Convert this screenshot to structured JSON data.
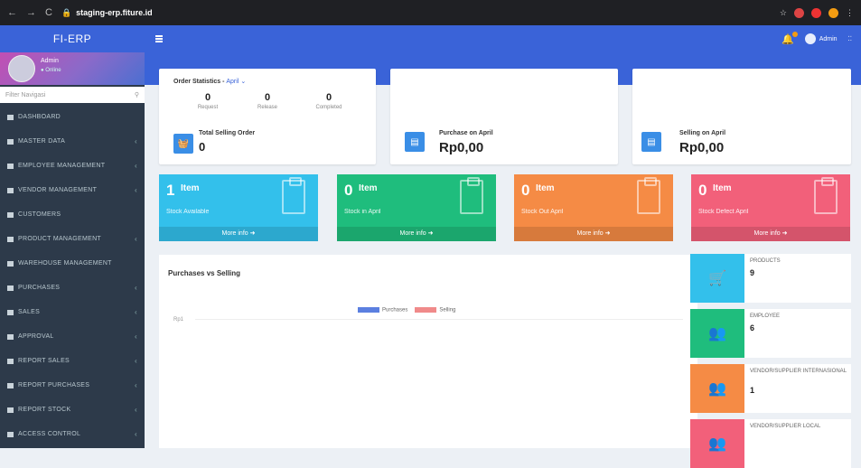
{
  "browser": {
    "url": "staging-erp.fiture.id"
  },
  "app": {
    "brand": "FI-ERP"
  },
  "user": {
    "name": "Admin",
    "status": "Online"
  },
  "search": {
    "placeholder": "Filter Navigasi"
  },
  "sidebar": {
    "items": [
      {
        "label": "DASHBOARD",
        "chevron": false
      },
      {
        "label": "MASTER DATA",
        "chevron": true
      },
      {
        "label": "EMPLOYEE MANAGEMENT",
        "chevron": true
      },
      {
        "label": "VENDOR MANAGEMENT",
        "chevron": true
      },
      {
        "label": "CUSTOMERS",
        "chevron": false
      },
      {
        "label": "PRODUCT MANAGEMENT",
        "chevron": true
      },
      {
        "label": "WAREHOUSE MANAGEMENT",
        "chevron": false
      },
      {
        "label": "PURCHASES",
        "chevron": true
      },
      {
        "label": "SALES",
        "chevron": true
      },
      {
        "label": "APPROVAL",
        "chevron": true
      },
      {
        "label": "REPORT SALES",
        "chevron": true
      },
      {
        "label": "REPORT PURCHASES",
        "chevron": true
      },
      {
        "label": "REPORT STOCK",
        "chevron": true
      },
      {
        "label": "ACCESS CONTROL",
        "chevron": true
      }
    ]
  },
  "topbar": {
    "user_label": "Admin"
  },
  "order_stats": {
    "title": "Order Statistics - ",
    "month": "April",
    "columns": [
      {
        "value": "0",
        "label": "Request"
      },
      {
        "value": "0",
        "label": "Release"
      },
      {
        "value": "0",
        "label": "Completed"
      }
    ],
    "total_label": "Total Selling Order",
    "total_value": "0"
  },
  "purchase_card": {
    "label": "Purchase on April",
    "value": "Rp0,00"
  },
  "selling_card": {
    "label": "Selling on April",
    "value": "Rp0,00"
  },
  "tiles": [
    {
      "num": "1",
      "unit": "Item",
      "label": "Stock Available",
      "more": "More info",
      "color": "#33c0eb"
    },
    {
      "num": "0",
      "unit": "Item",
      "label": "Stock in April",
      "more": "More info",
      "color": "#1fbd7d"
    },
    {
      "num": "0",
      "unit": "Item",
      "label": "Stock Out April",
      "more": "More info",
      "color": "#f58b45"
    },
    {
      "num": "0",
      "unit": "Item",
      "label": "Stock Defect April",
      "more": "More info",
      "color": "#f2607a"
    }
  ],
  "chart": {
    "title": "Purchases vs Selling",
    "legend": [
      {
        "name": "Purchases",
        "color": "#5b7fe0"
      },
      {
        "name": "Selling",
        "color": "#f08a8a"
      }
    ],
    "ytick": "Rp1"
  },
  "info_boxes": [
    {
      "label": "PRODUCTS",
      "value": "9",
      "color": "#33c0eb",
      "icon": "cart-icon"
    },
    {
      "label": "EMPLOYEE",
      "value": "6",
      "color": "#1fbd7d",
      "icon": "people-icon"
    },
    {
      "label": "VENDOR/SUPPLIER INTERNASIONAL",
      "value": "1",
      "color": "#f58b45",
      "icon": "people-icon"
    },
    {
      "label": "VENDOR/SUPPLIER LOCAL",
      "value": "",
      "color": "#f2607a",
      "icon": "people-icon"
    }
  ]
}
